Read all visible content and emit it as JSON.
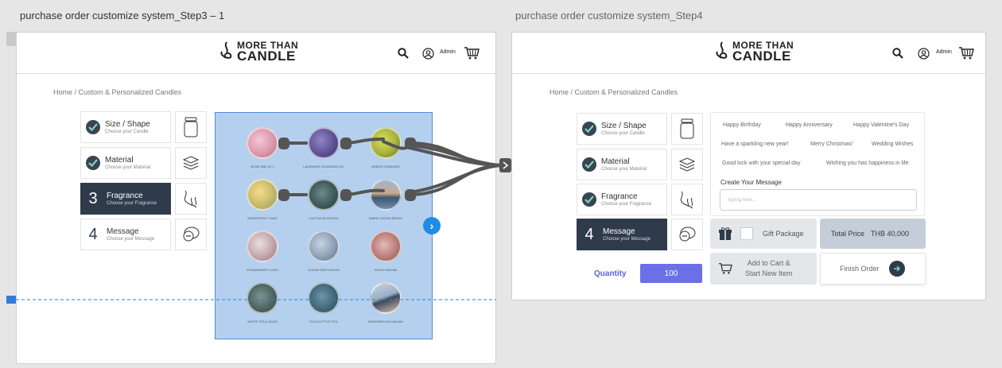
{
  "frames": {
    "left": {
      "title": "purchase order customize system_Step3 – 1"
    },
    "right": {
      "title": "purchase order customize system_Step4"
    }
  },
  "brand": {
    "line1": "MORE THAN",
    "line2": "CANDLE"
  },
  "header": {
    "admin_label": "Admin",
    "icons": [
      "search-icon",
      "user-icon",
      "cart-icon"
    ]
  },
  "breadcrumb": "Home / Custom & Personalized Candles",
  "steps": [
    {
      "title": "Size / Shape",
      "subtitle": "Choose your Candle",
      "icon": "jar-icon"
    },
    {
      "title": "Material",
      "subtitle": "Choose your Material",
      "icon": "layers-icon"
    },
    {
      "title": "Fragrance",
      "subtitle": "Choose your Fragrance",
      "icon": "scent-icon"
    },
    {
      "title": "Message",
      "subtitle": "Choose your Message",
      "icon": "chat-icon"
    }
  ],
  "step_numbers": {
    "fragrance": "3",
    "message": "4"
  },
  "scents": [
    "ROSE AND ATY",
    "LAVENDER LEGENDAS DO",
    "GREEN STANDARY",
    "GRAPEFRUIT SAGE",
    "CACTUS BLOSSOM",
    "WARM OCEAN BREEZ",
    "STRAWBERRY LUSH",
    "OCEAN DRIFTWOOD",
    "PEACH MELBA",
    "WHITE TEA & SAGE",
    "EUCALYPTUS TEA",
    "WATERMELON MALIBU"
  ],
  "messages": {
    "tags": [
      "Happy Birthday",
      "Happy Anniversary",
      "Happy Valentine's Day",
      "Have a sparkling new year!",
      "Merry Christmas!",
      "Wedding Wishes",
      "Good luck with your special day",
      "Wishing you has happiness in life"
    ],
    "create_label": "Create Your Message",
    "input_placeholder": "typing here..."
  },
  "order": {
    "gift_label": "Gift Package",
    "total_label": "Total Price",
    "total_value": "THB 40,000",
    "add_to_cart_label": "Add to Cart &\nStart New Item",
    "finish_label": "Finish Order",
    "quantity_label": "Quantity",
    "quantity_value": "100"
  },
  "colors": {
    "accent": "#2f3b4a",
    "overlay": "#78aae1",
    "quantity": "#6b6fe8",
    "next": "#1f8be6"
  }
}
